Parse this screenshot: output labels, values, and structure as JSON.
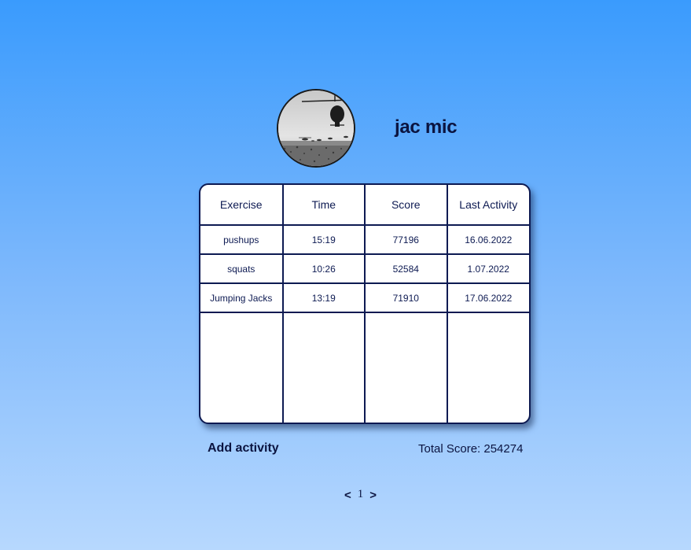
{
  "profile": {
    "name": "jac mic",
    "avatar_icon": "helicopter-photo"
  },
  "table": {
    "headers": [
      "Exercise",
      "Time",
      "Score",
      "Last Activity"
    ],
    "rows": [
      [
        "pushups",
        "15:19",
        "77196",
        "16.06.2022"
      ],
      [
        "squats",
        "10:26",
        "52584",
        "1.07.2022"
      ],
      [
        "Jumping Jacks",
        "13:19",
        "71910",
        "17.06.2022"
      ]
    ]
  },
  "footer": {
    "add_activity": "Add activity",
    "total_score": "Total Score: 254274"
  },
  "pagination": {
    "prev": "<",
    "page": "1",
    "next": ">"
  },
  "colors": {
    "background_top": "#3a9bfd",
    "background_bottom": "#b7d8fe",
    "table_border": "#0d1a52",
    "text": "#0b1440"
  }
}
